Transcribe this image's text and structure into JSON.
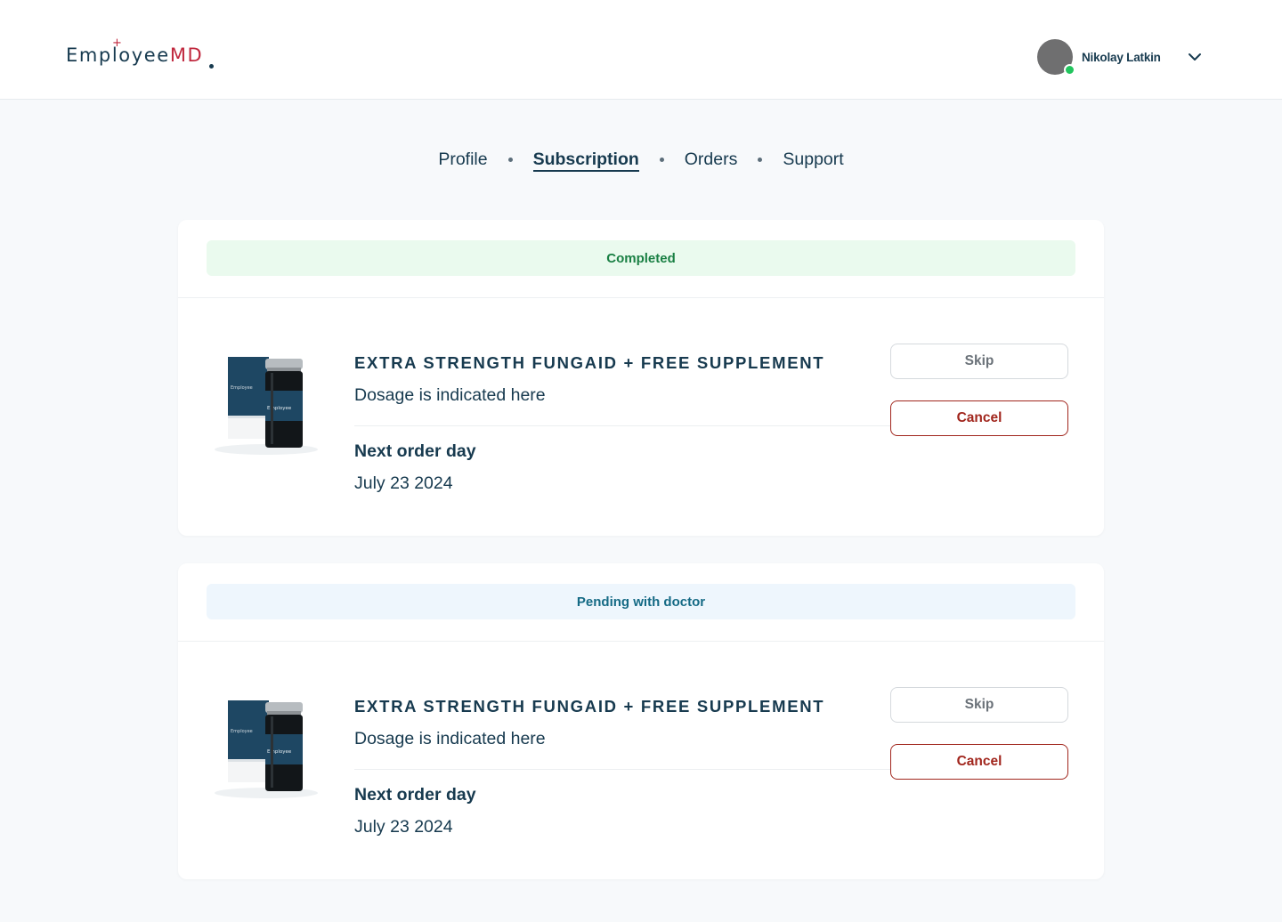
{
  "app": {
    "logo_main": "Employee",
    "logo_accent": "MD",
    "logo_plus": "+"
  },
  "user": {
    "name": "Nikolay Latkin",
    "status": "online"
  },
  "icons": {
    "chevron": "chevron-down-icon",
    "avatar": "avatar"
  },
  "nav": {
    "items": [
      {
        "label": "Profile",
        "active": false
      },
      {
        "label": "Subscription",
        "active": true
      },
      {
        "label": "Orders",
        "active": false
      },
      {
        "label": "Support",
        "active": false
      }
    ]
  },
  "subscriptions": [
    {
      "status": "Completed",
      "status_color": "#1a8044",
      "status_bg": "#eafaee",
      "product_title": "EXTRA STRENGTH FUNGAID + FREE SUPPLEMENT",
      "dosage": "Dosage is indicated here",
      "next_order_label": "Next order day",
      "next_order_date": "July 23 2024",
      "skip_label": "Skip",
      "cancel_label": "Cancel"
    },
    {
      "status": "Pending with doctor",
      "status_color": "#156a85",
      "status_bg": "#eef6fd",
      "product_title": "EXTRA STRENGTH FUNGAID + FREE SUPPLEMENT",
      "dosage": "Dosage is indicated here",
      "next_order_label": "Next order day",
      "next_order_date": "July 23 2024",
      "skip_label": "Skip",
      "cancel_label": "Cancel"
    }
  ],
  "colors": {
    "brand_navy": "#173a4f",
    "brand_red": "#c0283e",
    "cancel_red": "#a1261d",
    "page_bg": "#f7f9fb",
    "online_green": "#22c55e"
  }
}
